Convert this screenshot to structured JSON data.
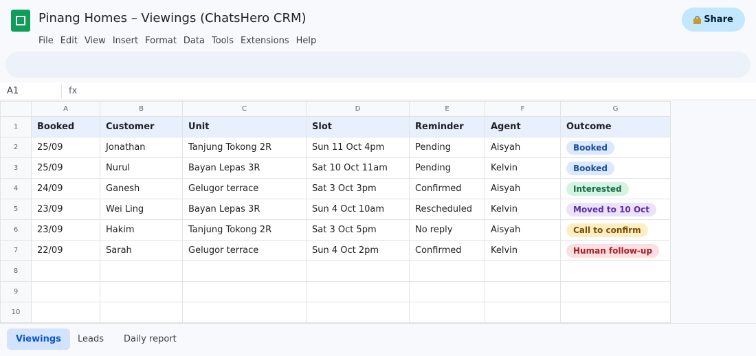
{
  "app": {
    "title": "Pinang Homes – Viewings (ChatsHero CRM)",
    "share_label": "Share",
    "menu": [
      "File",
      "Edit",
      "View",
      "Insert",
      "Format",
      "Data",
      "Tools",
      "Extensions",
      "Help"
    ],
    "accent": "#0b57d0",
    "logo_color": "#0f9d58"
  },
  "formula_bar": {
    "cell_ref": "A1",
    "fx_label": "fx",
    "value": ""
  },
  "sheet": {
    "column_letters": [
      "A",
      "B",
      "C",
      "D",
      "E",
      "F",
      "G"
    ],
    "row_numbers": [
      "1",
      "2",
      "3",
      "4",
      "5",
      "6",
      "7",
      "8",
      "9",
      "10"
    ],
    "header": [
      "Booked",
      "Customer",
      "Unit",
      "Slot",
      "Reminder",
      "Agent",
      "Outcome"
    ],
    "rows": [
      {
        "booked": "25/09",
        "customer": "Jonathan",
        "unit": "Tanjung Tokong 2R",
        "slot": "Sun 11 Oct 4pm",
        "reminder": "Pending",
        "agent": "Aisyah",
        "outcome": "Booked"
      },
      {
        "booked": "25/09",
        "customer": "Nurul",
        "unit": "Bayan Lepas 3R",
        "slot": "Sat 10 Oct 11am",
        "reminder": "Pending",
        "agent": "Kelvin",
        "outcome": "Booked"
      },
      {
        "booked": "24/09",
        "customer": "Ganesh",
        "unit": "Gelugor terrace",
        "slot": "Sat 3 Oct 3pm",
        "reminder": "Confirmed",
        "agent": "Aisyah",
        "outcome": "Interested"
      },
      {
        "booked": "23/09",
        "customer": "Wei Ling",
        "unit": "Bayan Lepas 3R",
        "slot": "Sun 4 Oct 10am",
        "reminder": "Rescheduled",
        "agent": "Kelvin",
        "outcome": "Moved to 10 Oct"
      },
      {
        "booked": "23/09",
        "customer": "Hakim",
        "unit": "Tanjung Tokong 2R",
        "slot": "Sat 3 Oct 5pm",
        "reminder": "No reply",
        "agent": "Aisyah",
        "outcome": "Call to confirm"
      },
      {
        "booked": "22/09",
        "customer": "Sarah",
        "unit": "Gelugor terrace",
        "slot": "Sun 4 Oct 2pm",
        "reminder": "Confirmed",
        "agent": "Kelvin",
        "outcome": "Human follow-up"
      }
    ],
    "outcome_colors": {
      "Booked": {
        "bg": "#dbe8fd",
        "fg": "#1a4fa0"
      },
      "Interested": {
        "bg": "#d4f3e3",
        "fg": "#146c43"
      },
      "Moved to 10 Oct": {
        "bg": "#ece3fb",
        "fg": "#5b2ca8"
      },
      "Call to confirm": {
        "bg": "#fdefc3",
        "fg": "#7a4e00"
      },
      "Human follow-up": {
        "bg": "#fbdfe1",
        "fg": "#a3202a"
      }
    }
  },
  "tabs": [
    {
      "label": "Viewings",
      "active": true
    },
    {
      "label": "Leads",
      "active": false
    },
    {
      "label": "Daily report",
      "active": false
    }
  ]
}
